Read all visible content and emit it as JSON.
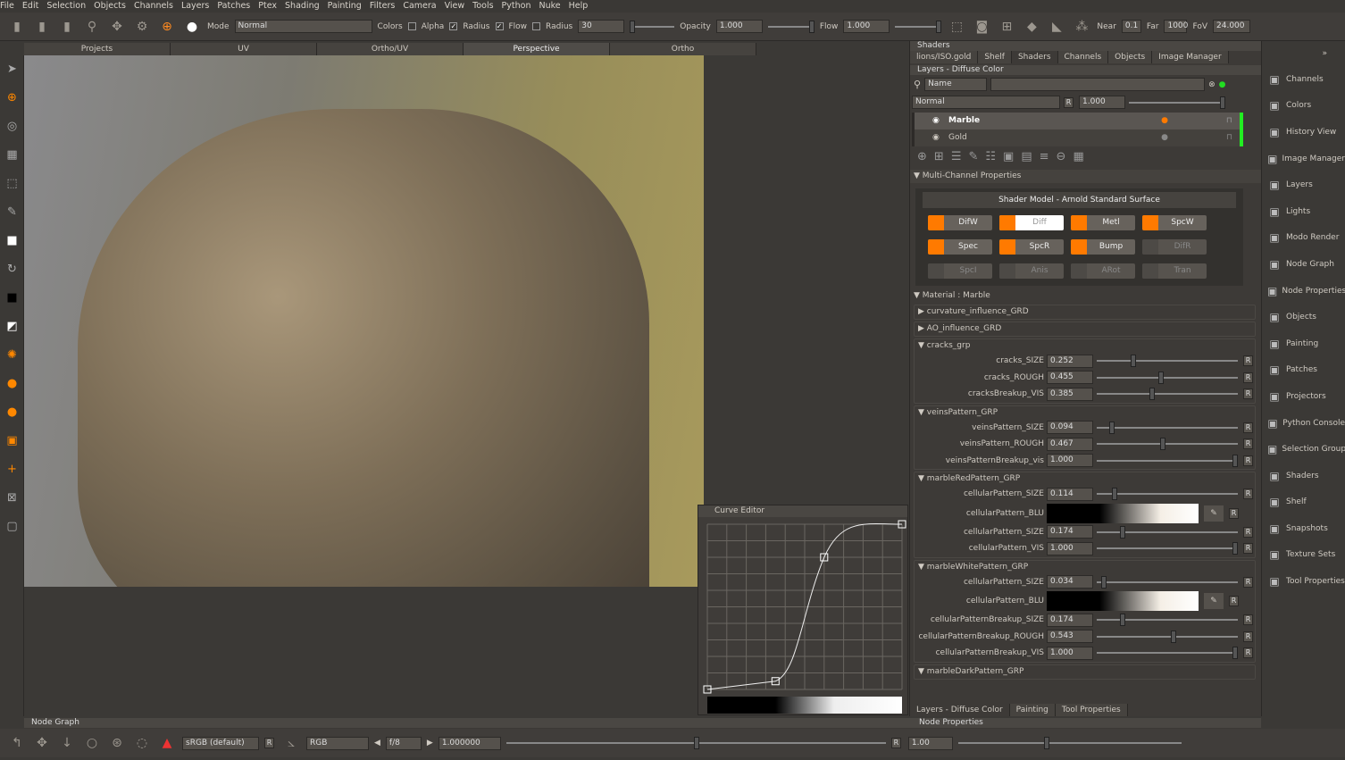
{
  "menu": [
    "File",
    "Edit",
    "Selection",
    "Objects",
    "Channels",
    "Layers",
    "Patches",
    "Ptex",
    "Shading",
    "Painting",
    "Filters",
    "Camera",
    "View",
    "Tools",
    "Python",
    "Nuke",
    "Help"
  ],
  "toolbar": {
    "mode_label": "Mode",
    "mode_value": "Normal",
    "colors": "Colors",
    "alpha": "Alpha",
    "radius_chk": "Radius",
    "flow_chk": "Flow",
    "radius_label": "Radius",
    "radius_value": "30",
    "opacity_label": "Opacity",
    "opacity_value": "1.000",
    "flow_label": "Flow",
    "flow_value": "1.000",
    "near_label": "Near",
    "near_value": "0.1",
    "far_label": "Far",
    "far_value": "1000",
    "fov_label": "FoV",
    "fov_value": "24.000",
    "alpha_checked": false,
    "radius_checked": true,
    "flow_checked": true,
    "radius2_checked": false
  },
  "viewport_tabs": [
    "Projects",
    "UV",
    "Ortho/UV",
    "Perspective",
    "Ortho"
  ],
  "curve_editor": {
    "title": "Curve Editor",
    "points": [
      [
        0,
        0
      ],
      [
        0.35,
        0.05
      ],
      [
        0.6,
        0.8
      ],
      [
        1,
        1
      ]
    ]
  },
  "shaders": {
    "title": "Shaders",
    "tabs": [
      "lions/ISO.gold",
      "Shelf",
      "Shaders",
      "Channels",
      "Objects",
      "Image Manager"
    ]
  },
  "layers": {
    "title": "Layers - Diffuse Color",
    "filter": "Name",
    "blend": "Normal",
    "opacity": "1.000",
    "items": [
      {
        "name": "Marble",
        "selected": true
      },
      {
        "name": "Gold",
        "selected": false
      }
    ],
    "accent": "#ff7a00",
    "indicator": "#22ee22"
  },
  "mcp": {
    "title": "Multi-Channel Properties",
    "shader_model": "Shader Model - Arnold Standard Surface",
    "channels": [
      {
        "label": "DifW",
        "on": true
      },
      {
        "label": "Diff",
        "on": true,
        "selected": true
      },
      {
        "label": "Metl",
        "on": true
      },
      {
        "label": "SpcW",
        "on": true
      },
      {
        "label": "Spec",
        "on": true
      },
      {
        "label": "SpcR",
        "on": true
      },
      {
        "label": "Bump",
        "on": true
      },
      {
        "label": "DifR",
        "on": false
      },
      {
        "label": "SpcI",
        "on": false
      },
      {
        "label": "Anis",
        "on": false
      },
      {
        "label": "ARot",
        "on": false
      },
      {
        "label": "Tran",
        "on": false
      }
    ]
  },
  "material": {
    "title": "Material : Marble",
    "collapsed": [
      "curvature_influence_GRD",
      "AO_influence_GRD"
    ],
    "groups": [
      {
        "name": "cracks_grp",
        "params": [
          {
            "label": "cracks_SIZE",
            "value": "0.252",
            "v": 0.252
          },
          {
            "label": "cracks_ROUGH",
            "value": "0.455",
            "v": 0.455
          },
          {
            "label": "cracksBreakup_VIS",
            "value": "0.385",
            "v": 0.385
          }
        ]
      },
      {
        "name": "veinsPattern_GRP",
        "params": [
          {
            "label": "veinsPattern_SIZE",
            "value": "0.094",
            "v": 0.094
          },
          {
            "label": "veinsPattern_ROUGH",
            "value": "0.467",
            "v": 0.467
          },
          {
            "label": "veinsPatternBreakup_vis",
            "value": "1.000",
            "v": 1
          }
        ]
      },
      {
        "name": "marbleRedPattern_GRP",
        "params": [
          {
            "label": "cellularPattern_SIZE",
            "value": "0.114",
            "v": 0.114
          },
          {
            "label": "cellularPattern_BLU",
            "ramp": true
          },
          {
            "label": "cellularPattern_SIZE",
            "value": "0.174",
            "v": 0.174
          },
          {
            "label": "cellularPattern_VIS",
            "value": "1.000",
            "v": 1
          }
        ]
      },
      {
        "name": "marbleWhitePattern_GRP",
        "params": [
          {
            "label": "cellularPattern_SIZE",
            "value": "0.034",
            "v": 0.034
          },
          {
            "label": "cellularPattern_BLU",
            "ramp": true
          },
          {
            "label": "cellularPatternBreakup_SIZE",
            "value": "0.174",
            "v": 0.174
          },
          {
            "label": "cellularPatternBreakup_ROUGH",
            "value": "0.543",
            "v": 0.543
          },
          {
            "label": "cellularPatternBreakup_VIS",
            "value": "1.000",
            "v": 1
          }
        ]
      }
    ],
    "last_group": "marbleDarkPattern_GRP"
  },
  "panel_tabs": [
    "Layers - Diffuse Color",
    "Painting",
    "Tool Properties"
  ],
  "reset": "R",
  "sidebar": [
    {
      "label": "Channels",
      "icon": "channels-icon"
    },
    {
      "label": "Colors",
      "icon": "colors-icon"
    },
    {
      "label": "History View",
      "icon": "history-icon"
    },
    {
      "label": "Image Manager",
      "icon": "image-icon"
    },
    {
      "label": "Layers",
      "icon": "layers-icon"
    },
    {
      "label": "Lights",
      "icon": "light-icon"
    },
    {
      "label": "Modo Render",
      "icon": "render-icon"
    },
    {
      "label": "Node Graph",
      "icon": "graph-icon"
    },
    {
      "label": "Node Properties",
      "icon": "properties-icon"
    },
    {
      "label": "Objects",
      "icon": "objects-icon"
    },
    {
      "label": "Painting",
      "icon": "paint-icon"
    },
    {
      "label": "Patches",
      "icon": "patches-icon"
    },
    {
      "label": "Projectors",
      "icon": "projector-icon"
    },
    {
      "label": "Python Console",
      "icon": "python-icon"
    },
    {
      "label": "Selection Groups",
      "icon": "selection-icon"
    },
    {
      "label": "Shaders",
      "icon": "shader-icon"
    },
    {
      "label": "Shelf",
      "icon": "shelf-icon"
    },
    {
      "label": "Snapshots",
      "icon": "snapshot-icon"
    },
    {
      "label": "Texture Sets",
      "icon": "texture-icon"
    },
    {
      "label": "Tool Properties",
      "icon": "tool-icon"
    }
  ],
  "bottom": {
    "node_graph": "Node Graph",
    "node_properties": "Node Properties",
    "colorspace": "sRGB (default)",
    "channel": "RGB",
    "fstop": "f/8",
    "exposure": "1.000000",
    "gain": "1.00"
  }
}
